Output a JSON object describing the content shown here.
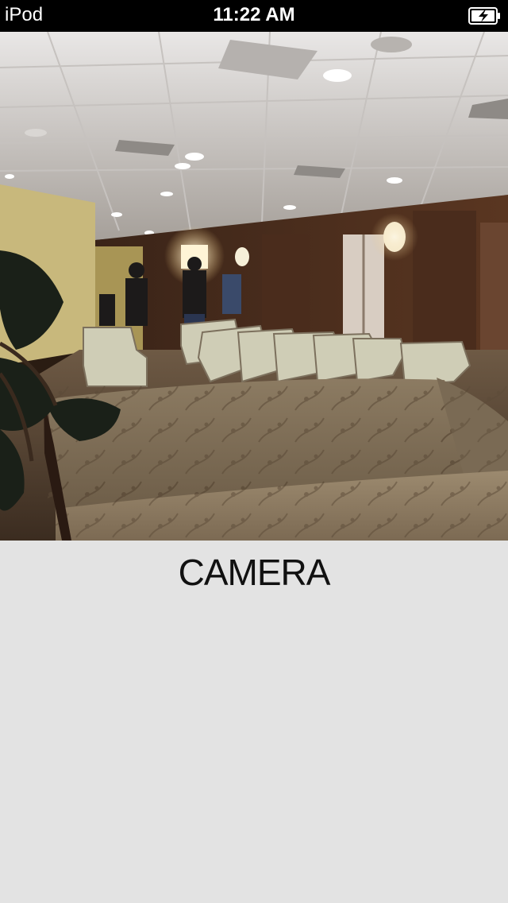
{
  "status_bar": {
    "carrier": "iPod",
    "time": "11:22 AM",
    "battery_icon": "battery-charging-icon"
  },
  "preview": {
    "icon": "camera-preview-image"
  },
  "screen": {
    "title": "CAMERA"
  },
  "colors": {
    "status_bar_bg": "#000000",
    "status_bar_text": "#ffffff",
    "screen_bg": "#e3e3e3",
    "title_text": "#111111"
  }
}
